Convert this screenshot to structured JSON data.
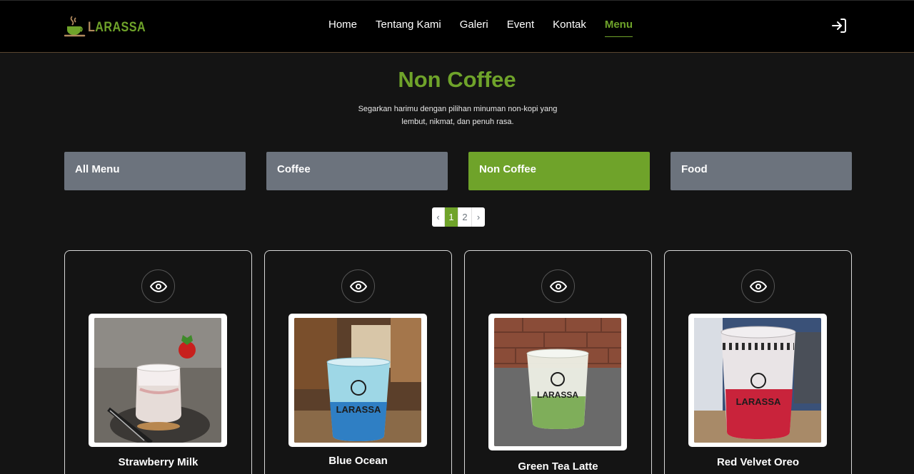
{
  "brand": {
    "logo_text": "LARASSA",
    "accent_color": "#6fa32a"
  },
  "nav": {
    "links": [
      {
        "label": "Home"
      },
      {
        "label": "Tentang Kami"
      },
      {
        "label": "Galeri"
      },
      {
        "label": "Event"
      },
      {
        "label": "Kontak"
      },
      {
        "label": "Menu",
        "active": true
      }
    ],
    "login_icon": "login-icon"
  },
  "hero": {
    "title": "Non Coffee",
    "subtitle_line1": "Segarkan harimu dengan pilihan minuman non-kopi yang",
    "subtitle_line2": "lembut, nikmat, dan penuh rasa."
  },
  "categories": [
    {
      "label": "All Menu"
    },
    {
      "label": "Coffee"
    },
    {
      "label": "Non Coffee",
      "active": true
    },
    {
      "label": "Food"
    }
  ],
  "pagination": {
    "prev": "‹",
    "pages": [
      "1",
      "2"
    ],
    "current": "1",
    "next": "›"
  },
  "items": [
    {
      "name": "Strawberry Milk",
      "icon": "eye-icon"
    },
    {
      "name": "Blue Ocean",
      "icon": "eye-icon"
    },
    {
      "name": "Green Tea Latte",
      "icon": "eye-icon"
    },
    {
      "name": "Red Velvet Oreo",
      "icon": "eye-icon"
    }
  ]
}
